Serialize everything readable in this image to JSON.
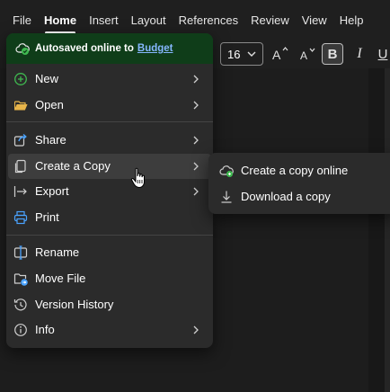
{
  "ribbon": {
    "tabs": [
      {
        "label": "File"
      },
      {
        "label": "Home"
      },
      {
        "label": "Insert"
      },
      {
        "label": "Layout"
      },
      {
        "label": "References"
      },
      {
        "label": "Review"
      },
      {
        "label": "View"
      },
      {
        "label": "Help"
      }
    ],
    "active_tab": "Home"
  },
  "toolbar": {
    "font_size": "16",
    "grow_font_icon": "grow-font-icon",
    "shrink_font_icon": "shrink-font-icon",
    "bold_label": "B",
    "italic_label": "I",
    "underline_label": "U"
  },
  "file_menu": {
    "autosave_text": "Autosaved online to",
    "autosave_location": "Budget",
    "items": [
      {
        "label": "New",
        "icon": "new-icon",
        "submenu": true
      },
      {
        "label": "Open",
        "icon": "folder-open-icon",
        "submenu": true
      },
      {
        "label": "Share",
        "icon": "share-icon",
        "submenu": true
      },
      {
        "label": "Create a Copy",
        "icon": "copy-icon",
        "submenu": true
      },
      {
        "label": "Export",
        "icon": "export-icon",
        "submenu": true
      },
      {
        "label": "Print",
        "icon": "print-icon",
        "submenu": false
      },
      {
        "label": "Rename",
        "icon": "rename-icon",
        "submenu": false
      },
      {
        "label": "Move File",
        "icon": "move-file-icon",
        "submenu": false
      },
      {
        "label": "Version History",
        "icon": "history-icon",
        "submenu": false
      },
      {
        "label": "Info",
        "icon": "info-icon",
        "submenu": true
      }
    ]
  },
  "submenu": {
    "items": [
      {
        "label": "Create a copy online",
        "icon": "cloud-copy-icon"
      },
      {
        "label": "Download a copy",
        "icon": "download-icon"
      }
    ]
  },
  "colors": {
    "background": "#1f1f1f",
    "menu_bg": "#2b2b2b",
    "autosave_bg": "#0f3d19",
    "link": "#86b7ff",
    "accent_green": "#3fb950",
    "accent_blue": "#4aa3ff"
  }
}
